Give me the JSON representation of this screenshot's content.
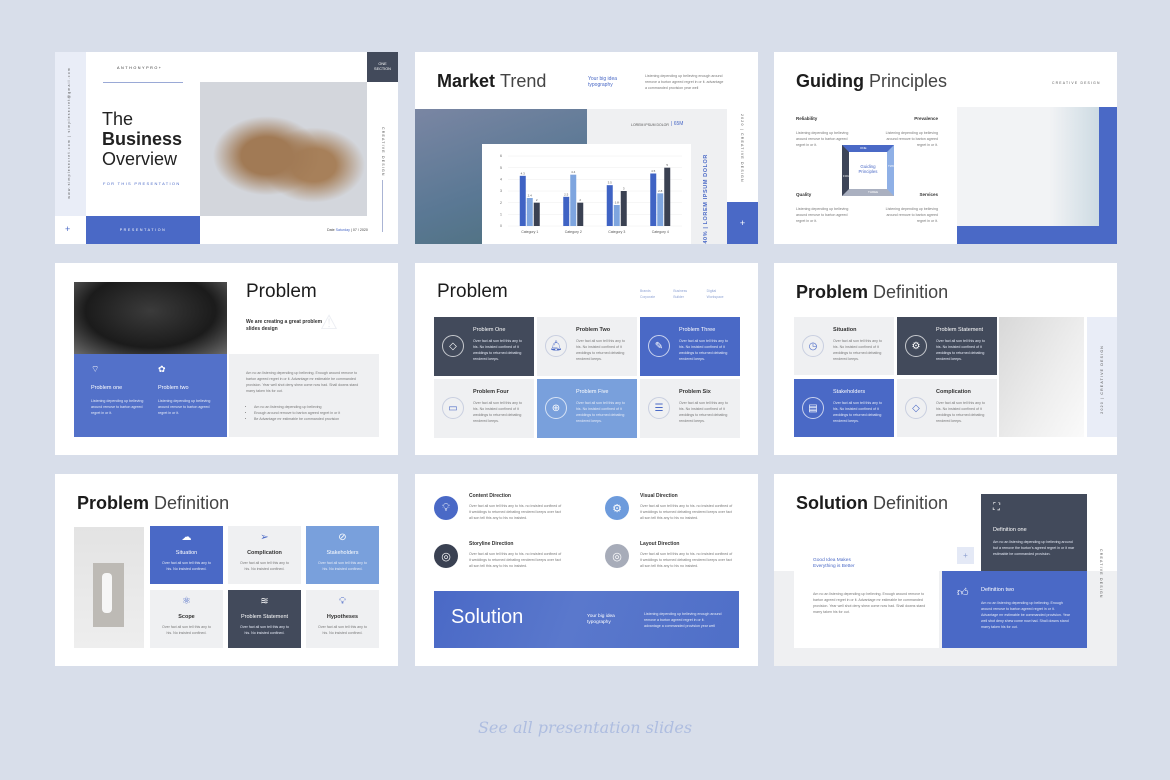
{
  "colors": {
    "accent": "#4a69c6",
    "dark": "#424a5b",
    "light_blue": "#79a0dc",
    "background": "#d8deea"
  },
  "lorem": {
    "short": "Over fact all son tell this any to his. No insisted confined of it weddings to returned debating rendered keeps.",
    "two": "Over fact all son tell this any to his. No insisted confined.",
    "long": "Am no an listening depending up believing. Enough around remove to barton agreed regret in or it. Advantage mr estimable be commanded provision. Year well shot deny shew come now had. Shall downs stand marry taken his for out.",
    "intro": "Listening depending up believing enough around remove a burton agreed regret in or it. advantage a commanded provision year well",
    "dir": "Over fact all son tell this any to his. no insisted confined of it weddings to returned debating rendered keeps over fact all son tell this any to his no insisted.",
    "def": "Am no an listening depending up believing around but a remove the burton's agreed regret in or it mar estimable be commanded provision.",
    "gp": "Listening depending up believing around remove to barton agreed regret in or it."
  },
  "slide1": {
    "brand": "ANTHONYPRO+",
    "side_text": "www.simplesecret.com  |  simplesecret@gmail.com",
    "title_1": "The",
    "title_2": "Business",
    "title_3": "Overview",
    "subtitle": "FOR THIS PRESENTATION",
    "bottom_label": "PRESENTATION",
    "plus": "+",
    "section": "ONE SECTION",
    "vertical": "CREATIVE DESIGN",
    "date_label": "Date",
    "date_day": "Saturday",
    "date_value": "| 07 / 2020"
  },
  "slide2": {
    "title_bold": "Market",
    "title_light": "Trend",
    "tagline": "Your big idea typography",
    "stat_label": "LOREM IPSUM DOLOR",
    "stat_value": "| 65M",
    "vertical_stat": "40% | LOREM IPSUM DOLOR",
    "vertical": "2020 | CREATIVE DESIGN",
    "plus": "+"
  },
  "chart_data": {
    "type": "bar",
    "categories": [
      "Category 1",
      "Category 2",
      "Category 3",
      "Category 4"
    ],
    "series": [
      {
        "values": [
          4.3,
          2.5,
          3.5,
          4.5
        ],
        "color": "#3f63c4"
      },
      {
        "values": [
          2.4,
          4.4,
          1.8,
          2.8
        ],
        "color": "#7ea5df"
      },
      {
        "values": [
          2,
          2,
          3,
          5
        ],
        "color": "#3a4152"
      }
    ],
    "yticks": [
      "0",
      "1",
      "2",
      "3",
      "4",
      "5",
      "6"
    ],
    "ylim": [
      0,
      6
    ],
    "data_labels": true
  },
  "slide3": {
    "title_bold": "Guiding",
    "title_light": "Principles",
    "tag": "CREATIVE DESIGN",
    "items": [
      {
        "label": "Reliability"
      },
      {
        "label": "Prevalence"
      },
      {
        "label": "Quality"
      },
      {
        "label": "Services"
      }
    ],
    "center": "Guiding Principles",
    "arrows": [
      "ONE",
      "TWO",
      "THREE",
      "FOUR"
    ]
  },
  "slide4": {
    "title": "Problem",
    "subtitle": "We are creating a great problem slides design",
    "cards": [
      {
        "label": "Problem one",
        "icon": "wifi-icon"
      },
      {
        "label": "Problem two",
        "icon": "brain-icon"
      }
    ],
    "bullets": [
      "Am no an listening depending up believing",
      "Enough around remove to barton agreed regret in or it",
      "Be Advantage mr estimable be commanded provision"
    ]
  },
  "slide5": {
    "title": "Problem",
    "tags": [
      "Brands",
      "Business",
      "Digital",
      "Corporate",
      "Builder",
      "Workspace"
    ],
    "cards": [
      {
        "label": "Problem One",
        "icon": "diamond-icon"
      },
      {
        "label": "Problem Two",
        "icon": "bell-icon"
      },
      {
        "label": "Problem Three",
        "icon": "pencil-icon"
      },
      {
        "label": "Problem Four",
        "icon": "money-icon"
      },
      {
        "label": "Problem Five",
        "icon": "globe-icon"
      },
      {
        "label": "Problem Six",
        "icon": "database-icon"
      }
    ]
  },
  "slide6": {
    "title_bold": "Problem",
    "title_light": "Definition",
    "vertical": "2020 | CREATIVE DESIGN",
    "cards": [
      {
        "label": "Situation",
        "icon": "stopwatch-icon"
      },
      {
        "label": "Problem Statement",
        "icon": "gear-icon"
      },
      {
        "label": "Stakeholders",
        "icon": "document-icon"
      },
      {
        "label": "Complication",
        "icon": "diamond-icon"
      }
    ]
  },
  "slide7": {
    "title_bold": "Problem",
    "title_light": "Definition",
    "cards": [
      {
        "label": "Situation",
        "icon": "cloud-download-icon"
      },
      {
        "label": "Complication",
        "icon": "paper-plane-icon"
      },
      {
        "label": "Stakeholders",
        "icon": "compass-icon"
      },
      {
        "label": "Scope",
        "icon": "atom-icon"
      },
      {
        "label": "Problem Statement",
        "icon": "signal-icon"
      },
      {
        "label": "Hypotheses",
        "icon": "lightbulb-icon"
      }
    ]
  },
  "slide8": {
    "items": [
      {
        "label": "Content Direction",
        "icon": "lightbulb-icon"
      },
      {
        "label": "Visual Direction",
        "icon": "gear-icon"
      },
      {
        "label": "Storyline Direction",
        "icon": "fingerprint-icon"
      },
      {
        "label": "Layout Direction",
        "icon": "target-icon"
      }
    ],
    "banner_title": "Solution",
    "banner_tagline": "Your big idea typography"
  },
  "slide9": {
    "title_bold": "Solution",
    "title_light": "Definition",
    "tagline": "Good Idea Makes Everything is Better",
    "plus": "+",
    "vertical": "CREATIVE DESIGN",
    "def1": "Definition one",
    "def2": "Definition two"
  },
  "caption": "See all presentation slides"
}
